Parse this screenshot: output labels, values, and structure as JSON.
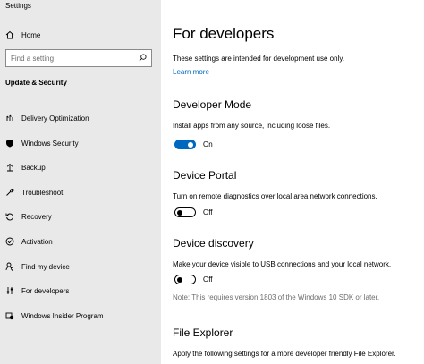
{
  "window": {
    "title": "Settings"
  },
  "sidebar": {
    "home_label": "Home",
    "search_placeholder": "Find a setting",
    "section_title": "Update & Security",
    "items": [
      {
        "label": "Delivery Optimization",
        "icon": "delivery-optimization-icon"
      },
      {
        "label": "Windows Security",
        "icon": "shield-icon"
      },
      {
        "label": "Backup",
        "icon": "backup-arrow-icon"
      },
      {
        "label": "Troubleshoot",
        "icon": "wrench-icon"
      },
      {
        "label": "Recovery",
        "icon": "recovery-icon"
      },
      {
        "label": "Activation",
        "icon": "activation-check-icon"
      },
      {
        "label": "Find my device",
        "icon": "person-location-icon"
      },
      {
        "label": "For developers",
        "icon": "developer-sliders-icon"
      },
      {
        "label": "Windows Insider Program",
        "icon": "insider-icon"
      }
    ]
  },
  "main": {
    "title": "For developers",
    "intro": "These settings are intended for development use only.",
    "learn_more": "Learn more",
    "developer_mode": {
      "heading": "Developer Mode",
      "description": "Install apps from any source, including loose files.",
      "state": "On"
    },
    "device_portal": {
      "heading": "Device Portal",
      "description": "Turn on remote diagnostics over local area network connections.",
      "state": "Off"
    },
    "device_discovery": {
      "heading": "Device discovery",
      "description": "Make your device visible to USB connections and your local network.",
      "state": "Off",
      "note": "Note: This requires version 1803 of the Windows 10 SDK or later."
    },
    "file_explorer": {
      "heading": "File Explorer",
      "description": "Apply the following settings for a more developer friendly File Explorer."
    }
  },
  "colors": {
    "accent": "#0067c0",
    "sidebar_bg": "#e9e9e9",
    "muted_text": "#6d6d6d"
  }
}
